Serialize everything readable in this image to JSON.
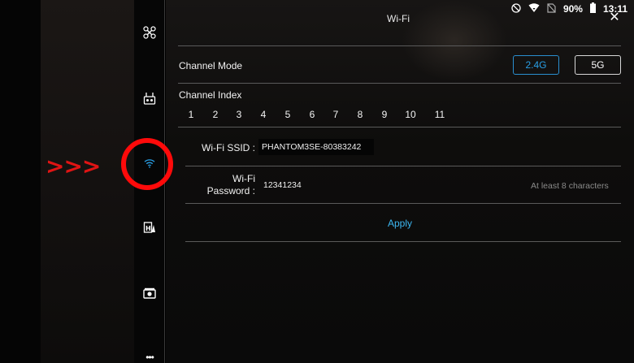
{
  "status_bar": {
    "battery": "90%",
    "time": "13:11"
  },
  "header": {
    "title": "Wi-Fi",
    "close_symbol": "✕"
  },
  "sidebar": {
    "items": [
      {
        "icon": "drone-icon"
      },
      {
        "icon": "remote-controller-icon"
      },
      {
        "icon": "wifi-icon",
        "selected": true
      },
      {
        "icon": "transmission-icon"
      },
      {
        "icon": "camera-icon"
      },
      {
        "icon": "more-icon",
        "symbol": "•••"
      }
    ]
  },
  "channel_mode": {
    "label": "Channel Mode",
    "options": [
      "2.4G",
      "5G"
    ],
    "selected": "2.4G"
  },
  "channel_index": {
    "label": "Channel Index",
    "channels": [
      "1",
      "2",
      "3",
      "4",
      "5",
      "6",
      "7",
      "8",
      "9",
      "10",
      "11"
    ]
  },
  "wifi_ssid": {
    "label": "Wi-Fi SSID :",
    "value": "PHANTOM3SE-80383242"
  },
  "wifi_password": {
    "label_line1": "Wi-Fi",
    "label_line2": "Password :",
    "value": "12341234",
    "hint": "At least 8 characters"
  },
  "apply_label": "Apply",
  "annotation": {
    "arrows": ">>>"
  },
  "colors": {
    "accent": "#2aa0e6",
    "apply": "#3cb7f0",
    "annotation": "#ff0a0a"
  }
}
